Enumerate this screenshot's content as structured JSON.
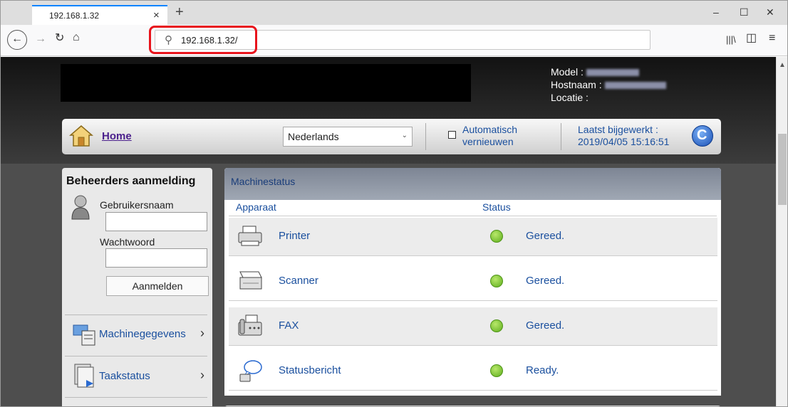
{
  "browser": {
    "tab_title": "192.168.1.32",
    "tab_close": "×",
    "new_tab": "+",
    "url": "192.168.1.32/",
    "window_controls": [
      "–",
      "☐",
      "✕"
    ]
  },
  "header": {
    "model_label": "Model :",
    "hostname_label": "Hostnaam :",
    "location_label": "Locatie :"
  },
  "topbar": {
    "home_label": "Home",
    "language_selected": "Nederlands",
    "auto_refresh_line1": "Automatisch",
    "auto_refresh_line2": "vernieuwen",
    "last_updated_label": "Laatst bijgewerkt :",
    "last_updated_value": "2019/04/05 15:16:51"
  },
  "login": {
    "title": "Beheerders aanmelding",
    "username_label": "Gebruikersnaam",
    "password_label": "Wachtwoord",
    "login_button": "Aanmelden"
  },
  "sidebar": {
    "items": [
      {
        "label": "Machinegegevens",
        "icon": "machine-info-icon"
      },
      {
        "label": "Taakstatus",
        "icon": "job-status-icon"
      }
    ]
  },
  "machine_status": {
    "title": "Machinestatus",
    "col_device": "Apparaat",
    "col_status": "Status",
    "rows": [
      {
        "device": "Printer",
        "status": "Gereed.",
        "status_color": "#6cc024",
        "icon": "printer-icon"
      },
      {
        "device": "Scanner",
        "status": "Gereed.",
        "status_color": "#6cc024",
        "icon": "scanner-icon"
      },
      {
        "device": "FAX",
        "status": "Gereed.",
        "status_color": "#6cc024",
        "icon": "fax-icon"
      },
      {
        "device": "Statusbericht",
        "status": "Ready.",
        "status_color": "#6cc024",
        "icon": "status-message-icon"
      }
    ]
  },
  "colors": {
    "link": "#1a4f9e",
    "home_link": "#4a1f8c",
    "highlight": "#e8141c",
    "browser_accent": "#0a84ff"
  }
}
